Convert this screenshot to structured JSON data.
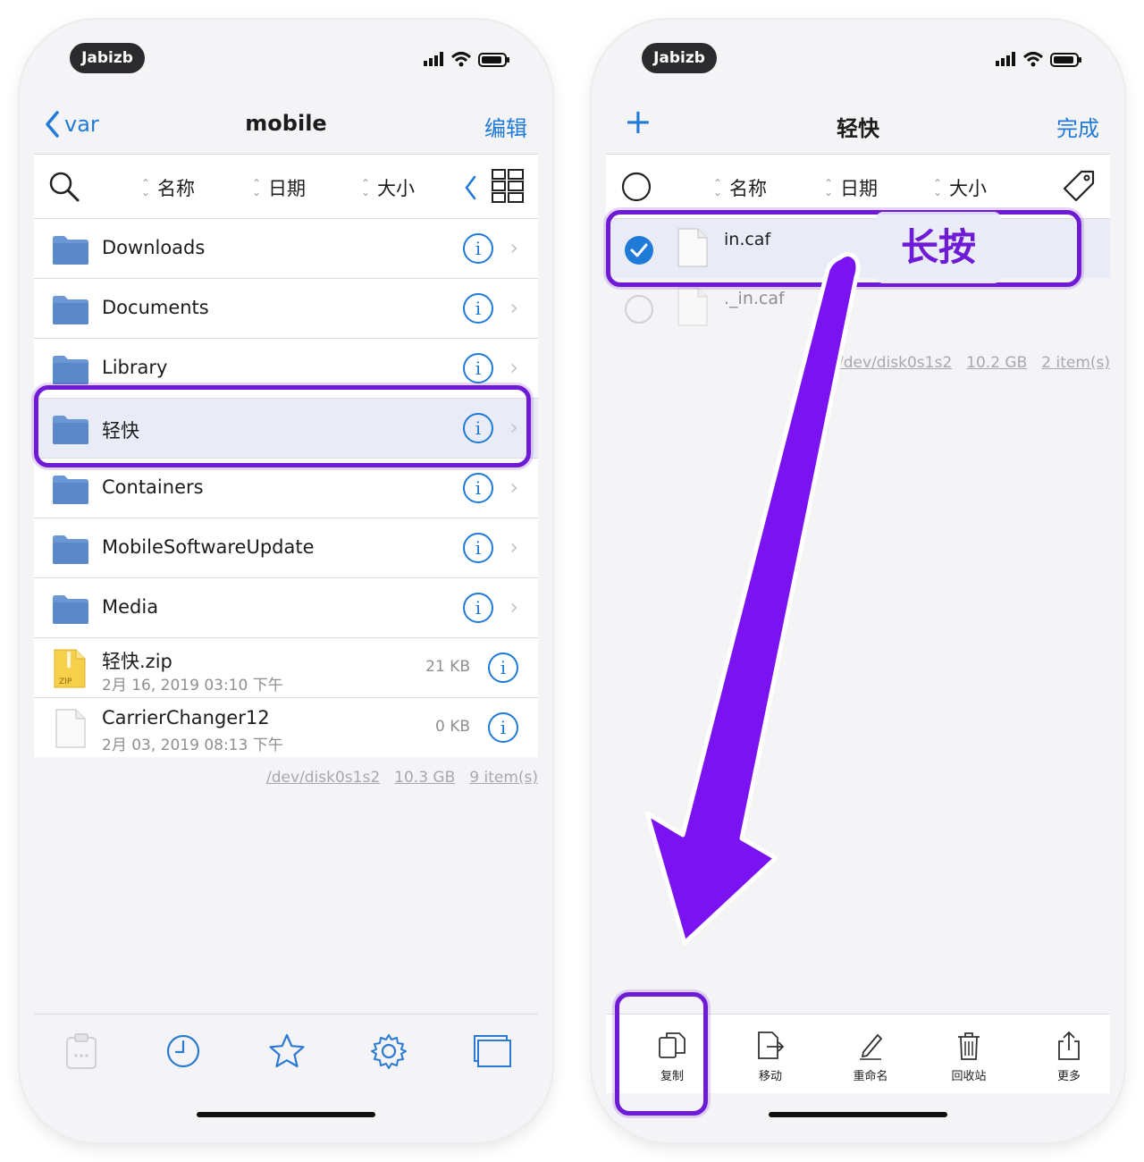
{
  "left": {
    "carrier": "Jabizb",
    "nav": {
      "back": "var",
      "title": "mobile",
      "edit": "编辑"
    },
    "sort": {
      "name": "名称",
      "date": "日期",
      "size": "大小"
    },
    "folders": [
      {
        "name": "Downloads"
      },
      {
        "name": "Documents"
      },
      {
        "name": "Library"
      },
      {
        "name": "轻快"
      },
      {
        "name": "Containers"
      },
      {
        "name": "MobileSoftwareUpdate"
      },
      {
        "name": "Media"
      }
    ],
    "files": [
      {
        "name": "轻快.zip",
        "date": "2月 16, 2019 03:10 下午",
        "size": "21 KB"
      },
      {
        "name": "CarrierChanger12",
        "date": "2月 03, 2019 08:13 下午",
        "size": "0 KB"
      }
    ],
    "footer": {
      "disk": "/dev/disk0s1s2",
      "capacity": "10.3 GB",
      "count": "9 item(s)"
    }
  },
  "right": {
    "carrier": "Jabizb",
    "nav": {
      "add": "+",
      "title": "轻快",
      "done": "完成"
    },
    "sort": {
      "name": "名称",
      "date": "日期",
      "size": "大小"
    },
    "files": [
      {
        "name": "in.caf",
        "selected": true
      },
      {
        "name": "._in.caf",
        "selected": false
      }
    ],
    "annotation": "长按",
    "footer": {
      "disk": "/dev/disk0s1s2",
      "capacity": "10.2 GB",
      "count": "2 item(s)"
    },
    "actions": [
      {
        "label": "复制",
        "icon": "copy-icon"
      },
      {
        "label": "移动",
        "icon": "move-icon"
      },
      {
        "label": "重命名",
        "icon": "rename-icon"
      },
      {
        "label": "回收站",
        "icon": "trash-icon"
      },
      {
        "label": "更多",
        "icon": "share-icon"
      }
    ]
  },
  "colors": {
    "accent": "#1f7ad8",
    "highlight": "#6f1bd6",
    "arrow": "#7a12f2",
    "folder": "#6b98d4"
  }
}
